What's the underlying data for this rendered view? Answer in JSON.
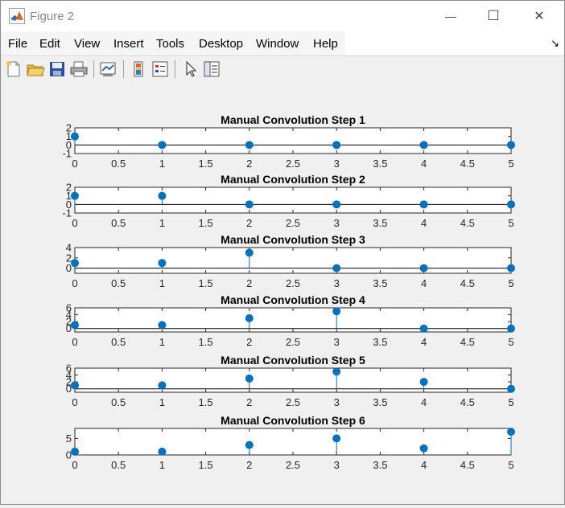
{
  "window": {
    "title": "Figure 2",
    "controls": {
      "minimize": "—",
      "maximize": "☐",
      "close": "✕"
    }
  },
  "menu": {
    "items": [
      "File",
      "Edit",
      "View",
      "Insert",
      "Tools",
      "Desktop",
      "Window",
      "Help"
    ],
    "dock_glyph": "↘"
  },
  "toolbar": {
    "buttons": [
      "new-figure-icon",
      "open-file-icon",
      "save-icon",
      "print-icon",
      "link-plot-icon",
      "colorbar-icon",
      "legend-icon",
      "pointer-icon",
      "property-inspector-icon"
    ]
  },
  "colors": {
    "stem": "#0072BD",
    "axes_bg": "#ffffff",
    "axes_line": "#262626"
  },
  "chart_data": [
    {
      "type": "stem",
      "title": "Manual Convolution Step 1",
      "x": [
        0,
        1,
        2,
        3,
        4,
        5
      ],
      "y": [
        1,
        0,
        0,
        0,
        0,
        0
      ],
      "xlim": [
        0,
        5
      ],
      "ylim": [
        -1,
        2
      ],
      "xticks": [
        "0",
        "0.5",
        "1",
        "1.5",
        "2",
        "2.5",
        "3",
        "3.5",
        "4",
        "4.5",
        "5"
      ],
      "yticks": [
        "2",
        "1",
        "0",
        "-1"
      ],
      "ytick_values": [
        2,
        1,
        0,
        -1
      ],
      "grid": false
    },
    {
      "type": "stem",
      "title": "Manual Convolution Step 2",
      "x": [
        0,
        1,
        2,
        3,
        4,
        5
      ],
      "y": [
        1,
        1,
        0,
        0,
        0,
        0
      ],
      "xlim": [
        0,
        5
      ],
      "ylim": [
        -1,
        2
      ],
      "xticks": [
        "0",
        "0.5",
        "1",
        "1.5",
        "2",
        "2.5",
        "3",
        "3.5",
        "4",
        "4.5",
        "5"
      ],
      "yticks": [
        "2",
        "1",
        "0",
        "-1"
      ],
      "ytick_values": [
        2,
        1,
        0,
        -1
      ],
      "grid": false
    },
    {
      "type": "stem",
      "title": "Manual Convolution Step 3",
      "x": [
        0,
        1,
        2,
        3,
        4,
        5
      ],
      "y": [
        1,
        1,
        3,
        0,
        0,
        0
      ],
      "xlim": [
        0,
        5
      ],
      "ylim": [
        -1,
        4
      ],
      "xticks": [
        "0",
        "0.5",
        "1",
        "1.5",
        "2",
        "2.5",
        "3",
        "3.5",
        "4",
        "4.5",
        "5"
      ],
      "yticks": [
        "4",
        "2",
        "0"
      ],
      "ytick_values": [
        4,
        2,
        0
      ],
      "grid": false
    },
    {
      "type": "stem",
      "title": "Manual Convolution Step 4",
      "x": [
        0,
        1,
        2,
        3,
        4,
        5
      ],
      "y": [
        1,
        1,
        3,
        5,
        0,
        0
      ],
      "xlim": [
        0,
        5
      ],
      "ylim": [
        -1,
        6
      ],
      "xticks": [
        "0",
        "0.5",
        "1",
        "1.5",
        "2",
        "2.5",
        "3",
        "3.5",
        "4",
        "4.5",
        "5"
      ],
      "yticks": [
        "6",
        "4",
        "2",
        "0"
      ],
      "ytick_values": [
        6,
        4,
        2,
        0
      ],
      "grid": false
    },
    {
      "type": "stem",
      "title": "Manual Convolution Step 5",
      "x": [
        0,
        1,
        2,
        3,
        4,
        5
      ],
      "y": [
        1,
        1,
        3,
        5,
        2,
        0
      ],
      "xlim": [
        0,
        5
      ],
      "ylim": [
        -1,
        6
      ],
      "xticks": [
        "0",
        "0.5",
        "1",
        "1.5",
        "2",
        "2.5",
        "3",
        "3.5",
        "4",
        "4.5",
        "5"
      ],
      "yticks": [
        "6",
        "4",
        "2",
        "0"
      ],
      "ytick_values": [
        6,
        4,
        2,
        0
      ],
      "grid": false
    },
    {
      "type": "stem",
      "title": "Manual Convolution Step 6",
      "x": [
        0,
        1,
        2,
        3,
        4,
        5
      ],
      "y": [
        1,
        1,
        3,
        5,
        2,
        7
      ],
      "xlim": [
        0,
        5
      ],
      "ylim": [
        0,
        8
      ],
      "xticks": [
        "0",
        "0.5",
        "1",
        "1.5",
        "2",
        "2.5",
        "3",
        "3.5",
        "4",
        "4.5",
        "5"
      ],
      "yticks": [
        "5",
        "0"
      ],
      "ytick_values": [
        5,
        0
      ],
      "grid": false
    }
  ]
}
